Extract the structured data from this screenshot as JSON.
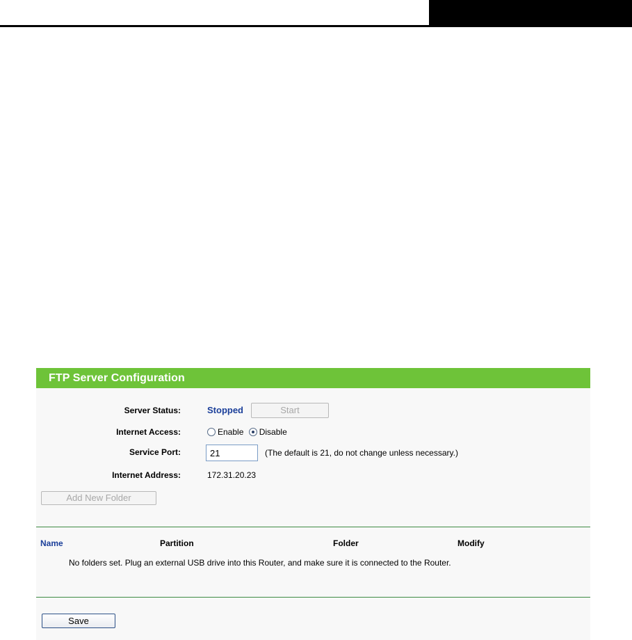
{
  "panel": {
    "title": "FTP Server Configuration"
  },
  "server_status": {
    "label": "Server Status:",
    "value": "Stopped",
    "start_button": "Start"
  },
  "internet_access": {
    "label": "Internet Access:",
    "options": [
      {
        "label": "Enable",
        "checked": false
      },
      {
        "label": "Disable",
        "checked": true
      }
    ]
  },
  "service_port": {
    "label": "Service Port:",
    "value": "21",
    "note": "(The default is 21, do not change unless necessary.)"
  },
  "internet_address": {
    "label": "Internet Address:",
    "value": "172.31.20.23"
  },
  "add_folder_button": "Add New Folder",
  "folders_table": {
    "columns": [
      "Name",
      "Partition",
      "Folder",
      "Modify"
    ],
    "empty_message": "No folders set. Plug an external USB drive into this Router, and make sure it is connected to the Router."
  },
  "save_button": "Save",
  "colors": {
    "header_green": "#6ec339",
    "status_blue": "#1b3f9a",
    "divider_green": "#3d8a43"
  }
}
